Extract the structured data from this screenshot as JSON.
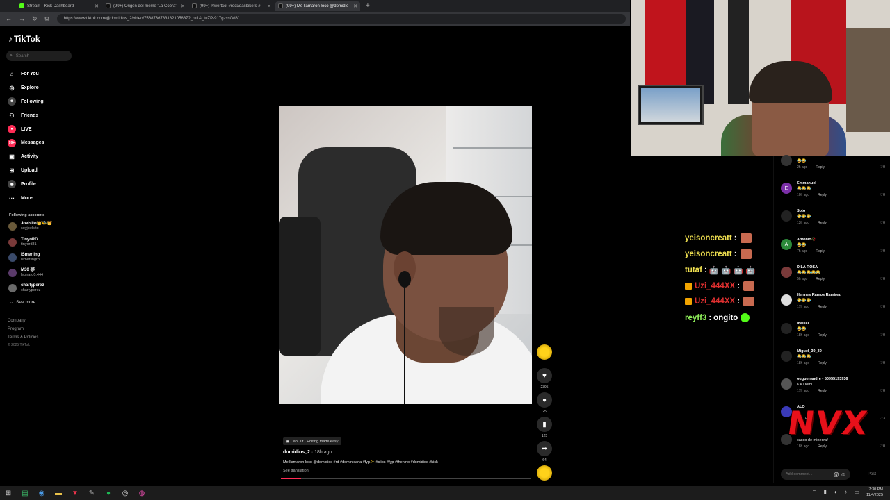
{
  "browser": {
    "tabs": [
      {
        "title": "Stream - Kick Dashboard",
        "color": "#53fc18",
        "active": false
      },
      {
        "title": "(99+) Origen del meme 'La Cobra'",
        "color": "#ffffff",
        "active": false
      },
      {
        "title": "(99+) #fwertcol #rodadasbikers #",
        "color": "#ffffff",
        "active": false
      },
      {
        "title": "(99+) Me llamaron loco @domidio",
        "color": "#ffffff",
        "active": true
      }
    ],
    "new_tab": "+",
    "url": "https://www.tiktok.com/@domidios_2/video/7568736783182105887?_r=1&_t=ZP-917gzssGd8f"
  },
  "sidebar": {
    "logo": "TikTok",
    "search_placeholder": "Search",
    "menu": [
      {
        "label": "For You",
        "icon": "home-icon",
        "glyph": "⌂"
      },
      {
        "label": "Explore",
        "icon": "compass-icon",
        "glyph": "◎"
      },
      {
        "label": "Following",
        "icon": "following-icon",
        "glyph": "☻"
      },
      {
        "label": "Friends",
        "icon": "friends-icon",
        "glyph": "⚇"
      },
      {
        "label": "LIVE",
        "icon": "live-icon",
        "glyph": "●"
      },
      {
        "label": "Messages",
        "icon": "messages-icon",
        "glyph": "99+"
      },
      {
        "label": "Activity",
        "icon": "activity-icon",
        "glyph": "▣"
      },
      {
        "label": "Upload",
        "icon": "upload-icon",
        "glyph": "⊞"
      },
      {
        "label": "Profile",
        "icon": "profile-icon",
        "glyph": "◉"
      },
      {
        "label": "More",
        "icon": "more-icon",
        "glyph": "···"
      }
    ],
    "following_title": "Following accounts",
    "accounts": [
      {
        "name": "Joelsito👑🐝👑",
        "handle": "soyjoelsito"
      },
      {
        "name": "TinyoRD",
        "handle": "tinyord31"
      },
      {
        "name": "iSmerling",
        "handle": "ismerlingrp"
      },
      {
        "name": "M30 🐺",
        "handle": "leonard0.444"
      },
      {
        "name": "charlyperez",
        "handle": "charlyperez"
      }
    ],
    "see_more": "See more",
    "footer": [
      "Company",
      "Program",
      "Terms & Policies",
      "© 2025 TikTok"
    ]
  },
  "video": {
    "capcut_label": "CapCut · Editing made easy",
    "author": "domidios_2",
    "time": "· 18h ago",
    "description": "Me llamaron loco @domidios #rd #dominicana #fyp✨ #clips #fyp #thenino #domidios #kick",
    "see_translation": "See translation",
    "progress_fraction": 0.08,
    "actions": [
      {
        "name": "like",
        "icon": "heart-icon",
        "glyph": "♥",
        "count": "2395"
      },
      {
        "name": "comment",
        "icon": "comment-icon",
        "glyph": "●",
        "count": "25"
      },
      {
        "name": "save",
        "icon": "bookmark-icon",
        "glyph": "▮",
        "count": "125"
      },
      {
        "name": "share",
        "icon": "share-icon",
        "glyph": "➦",
        "count": "64"
      }
    ]
  },
  "stream_chat": [
    {
      "user": "yeisoncreatt",
      "sep": ":",
      "msg": "",
      "emote": true,
      "user_color": "yellow"
    },
    {
      "user": "yeisoncreatt",
      "sep": ":",
      "msg": "",
      "emote": true,
      "user_color": "yellow"
    },
    {
      "user": "tutaf",
      "sep": ":",
      "msg": "🤖 🤖 🤖 🤖",
      "emote": false,
      "user_color": "yellow"
    },
    {
      "user": "Uzi_444XX",
      "sep": ":",
      "msg": "",
      "emote": true,
      "user_color": "red"
    },
    {
      "user": "Uzi_444XX",
      "sep": ":",
      "msg": "",
      "emote": true,
      "user_color": "red"
    },
    {
      "user": "reyff3",
      "sep": ":",
      "msg": "ongito",
      "emote": false,
      "user_color": "green"
    }
  ],
  "comments": [
    {
      "name": "",
      "text": "😂😂",
      "time": "2h ago",
      "likes": "0",
      "avatar": ""
    },
    {
      "name": "Emmanuel",
      "text": "😂😂😂",
      "time": "10h ago",
      "likes": "0",
      "avatar": "E"
    },
    {
      "name": "Soto",
      "text": "😂😂😂",
      "time": "13h ago",
      "likes": "0",
      "avatar": ""
    },
    {
      "name": "Antonio🥀",
      "text": "😂😂",
      "time": "7h ago",
      "likes": "0",
      "avatar": "A"
    },
    {
      "name": "D LA ROSA",
      "text": "😂😂😂😂😂",
      "time": "5h ago",
      "likes": "0",
      "avatar": ""
    },
    {
      "name": "Hermes Ramos Ramirez",
      "text": "😂😂😂",
      "time": "17h ago",
      "likes": "0",
      "avatar": ""
    },
    {
      "name": "maikel",
      "text": "😂😂",
      "time": "18h ago",
      "likes": "0",
      "avatar": ""
    },
    {
      "name": "Miguel_30_30",
      "text": "😂😂😂",
      "time": "18h ago",
      "likes": "0",
      "avatar": ""
    },
    {
      "name": "ouguenandre • 50955193936",
      "text": "Klk Domi",
      "time": "17h ago",
      "likes": "0",
      "avatar": ""
    },
    {
      "name": "ALO",
      "text": "",
      "time": "",
      "likes": "3",
      "avatar": ""
    },
    {
      "name": "",
      "text": "casco de minecraf",
      "time": "18h ago",
      "likes": "0",
      "avatar": ""
    }
  ],
  "comment_input": {
    "placeholder": "Add comment...",
    "post": "Post",
    "icons": "@ ☺"
  },
  "reply_label": "Reply",
  "overlay_logo": "NVX",
  "taskbar": {
    "time": "7:30 PM",
    "date": "11/4/2025",
    "apps": [
      "windows-icon",
      "terminal-icon",
      "chrome-icon",
      "folder-icon",
      "app-icon",
      "pen-icon",
      "spotify-icon",
      "obs-icon",
      "browser-icon"
    ]
  },
  "colors": {
    "accent": "#fe2c55",
    "kick_green": "#53fc18",
    "chat_yellow": "#f0e050",
    "chat_red": "#e03030"
  }
}
